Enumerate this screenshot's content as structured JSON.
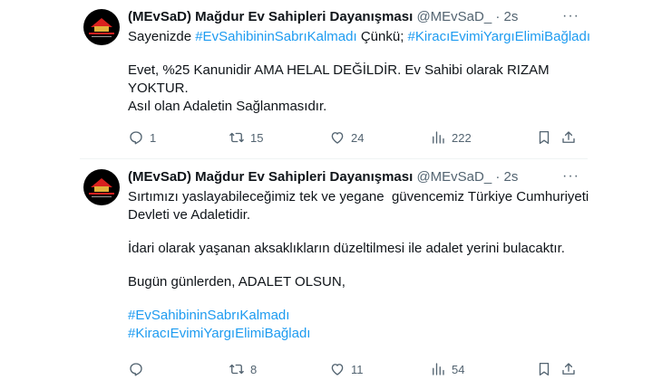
{
  "tweets": [
    {
      "author": {
        "name": "(MEvSaD) Mağdur Ev Sahipleri Dayanışması",
        "handle": "@MEvSaD_",
        "separator": "·",
        "time": "2s"
      },
      "more_label": "···",
      "text_lines": [
        {
          "segments": [
            {
              "text": "Sayenizde ",
              "hashtag": false
            },
            {
              "text": "#EvSahibininSabrıKalmadı",
              "hashtag": true
            },
            {
              "text": " Çünkü; ",
              "hashtag": false
            },
            {
              "text": "#KiracıEvimiYargıElimiBağladı",
              "hashtag": true
            }
          ]
        },
        {
          "blank": true
        },
        {
          "segments": [
            {
              "text": "Evet, %25 Kanunidir AMA HELAL DEĞİLDİR. Ev Sahibi olarak RIZAM",
              "hashtag": false
            }
          ]
        },
        {
          "segments": [
            {
              "text": "YOKTUR.",
              "hashtag": false
            }
          ]
        },
        {
          "segments": [
            {
              "text": "Asıl olan Adaletin Sağlanmasıdır.",
              "hashtag": false
            }
          ]
        }
      ],
      "stats": {
        "replies": "1",
        "retweets": "15",
        "likes": "24",
        "views": "222"
      }
    },
    {
      "author": {
        "name": "(MEvSaD) Mağdur Ev Sahipleri Dayanışması",
        "handle": "@MEvSaD_",
        "separator": "·",
        "time": "2s"
      },
      "more_label": "···",
      "text_lines": [
        {
          "segments": [
            {
              "text": "Sırtımızı yaslayabileceğimiz tek ve yegane  güvencemiz Türkiye Cumhuriyeti",
              "hashtag": false
            }
          ]
        },
        {
          "segments": [
            {
              "text": "Devleti ve Adaletidir.",
              "hashtag": false
            }
          ]
        },
        {
          "blank": true
        },
        {
          "segments": [
            {
              "text": "İdari olarak yaşanan aksaklıkların düzeltilmesi ile adalet yerini bulacaktır.",
              "hashtag": false
            }
          ]
        },
        {
          "blank": true
        },
        {
          "segments": [
            {
              "text": "Bugün günlerden, ADALET OLSUN,",
              "hashtag": false
            }
          ]
        },
        {
          "blank": true
        },
        {
          "segments": [
            {
              "text": "#EvSahibininSabrıKalmadı",
              "hashtag": true
            }
          ]
        },
        {
          "segments": [
            {
              "text": "#KiracıEvimiYargıElimiBağladı",
              "hashtag": true
            }
          ]
        }
      ],
      "stats": {
        "replies": "",
        "retweets": "8",
        "likes": "11",
        "views": "54"
      }
    }
  ],
  "icons": [
    "reply-icon",
    "retweet-icon",
    "like-icon",
    "views-icon",
    "bookmark-icon",
    "share-icon",
    "more-icon"
  ],
  "colors": {
    "hashtag": "#1d9bf0",
    "secondary_text": "#536471",
    "primary_text": "#0f1419",
    "divider": "#eff3f4"
  }
}
